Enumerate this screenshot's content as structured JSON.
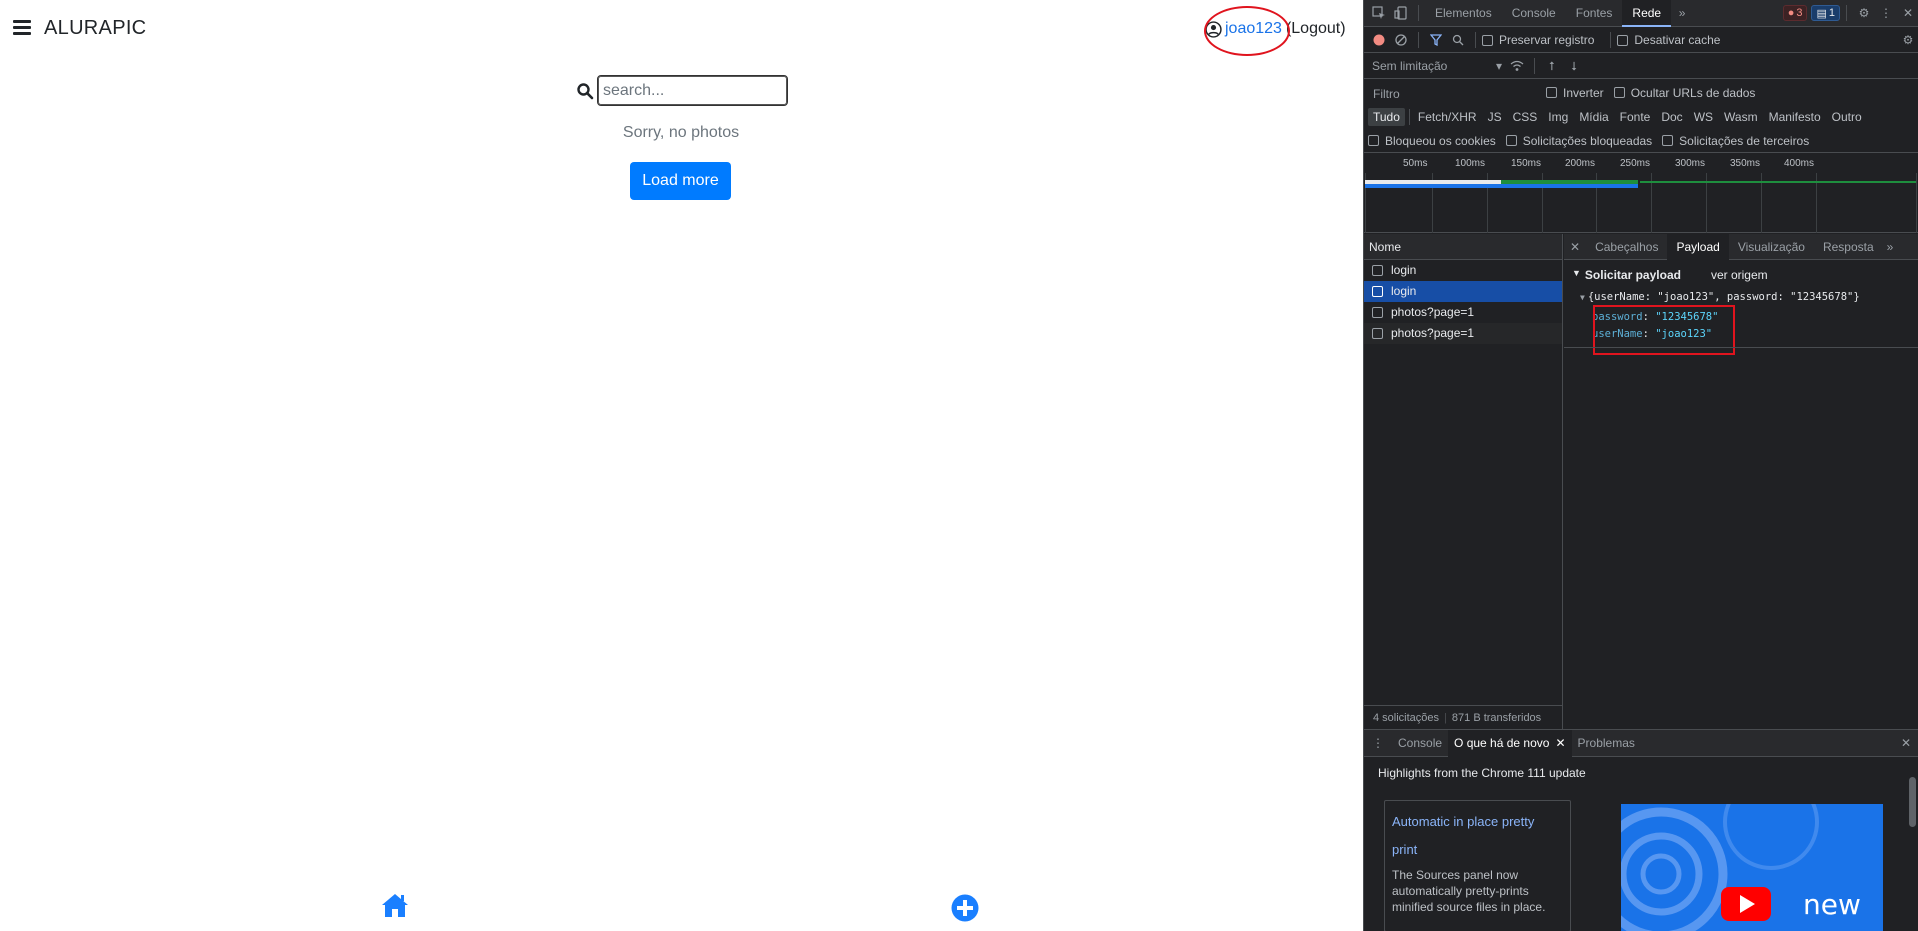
{
  "app": {
    "brand": "ALURAPIC",
    "user": "joao123",
    "logout": "(Logout)",
    "search_placeholder": "search...",
    "empty_message": "Sorry, no photos",
    "load_more": "Load more"
  },
  "devtools": {
    "tabs": [
      "Elementos",
      "Console",
      "Fontes",
      "Rede"
    ],
    "active_tab": "Rede",
    "error_count": "3",
    "message_count": "1",
    "toolbar": {
      "preserve_log": "Preservar registro",
      "disable_cache": "Desativar cache"
    },
    "throttling": "Sem limitação",
    "filter_placeholder": "Filtro",
    "invert": "Inverter",
    "hide_data_urls": "Ocultar URLs de dados",
    "types": [
      "Tudo",
      "Fetch/XHR",
      "JS",
      "CSS",
      "Img",
      "Mídia",
      "Fonte",
      "Doc",
      "WS",
      "Wasm",
      "Manifesto",
      "Outro"
    ],
    "blocked_cookies": "Bloqueou os cookies",
    "blocked_requests": "Solicitações bloqueadas",
    "third_party": "Solicitações de terceiros",
    "timeline_ticks": [
      "50ms",
      "100ms",
      "150ms",
      "200ms",
      "250ms",
      "300ms",
      "350ms",
      "400ms"
    ],
    "requests_header": "Nome",
    "requests": [
      "login",
      "login",
      "photos?page=1",
      "photos?page=1"
    ],
    "status": {
      "requests": "4 solicitações",
      "transferred": "871 B transferidos"
    },
    "detail_tabs": [
      "Cabeçalhos",
      "Payload",
      "Visualização",
      "Resposta"
    ],
    "payload": {
      "title": "Solicitar payload",
      "view_source": "ver origem",
      "summary": "{userName: \"joao123\", password: \"12345678\"}",
      "password_key": "password",
      "password_value": "\"12345678\"",
      "username_key": "userName",
      "username_value": "\"joao123\""
    },
    "drawer": {
      "tabs": [
        "Console",
        "O que há de novo",
        "Problemas"
      ],
      "highlight_title": "Highlights from the Chrome 111 update",
      "card_title": "Automatic in place pretty print",
      "card_body": "The Sources panel now automatically pretty-prints minified source files in place.",
      "video_text": "new"
    }
  }
}
